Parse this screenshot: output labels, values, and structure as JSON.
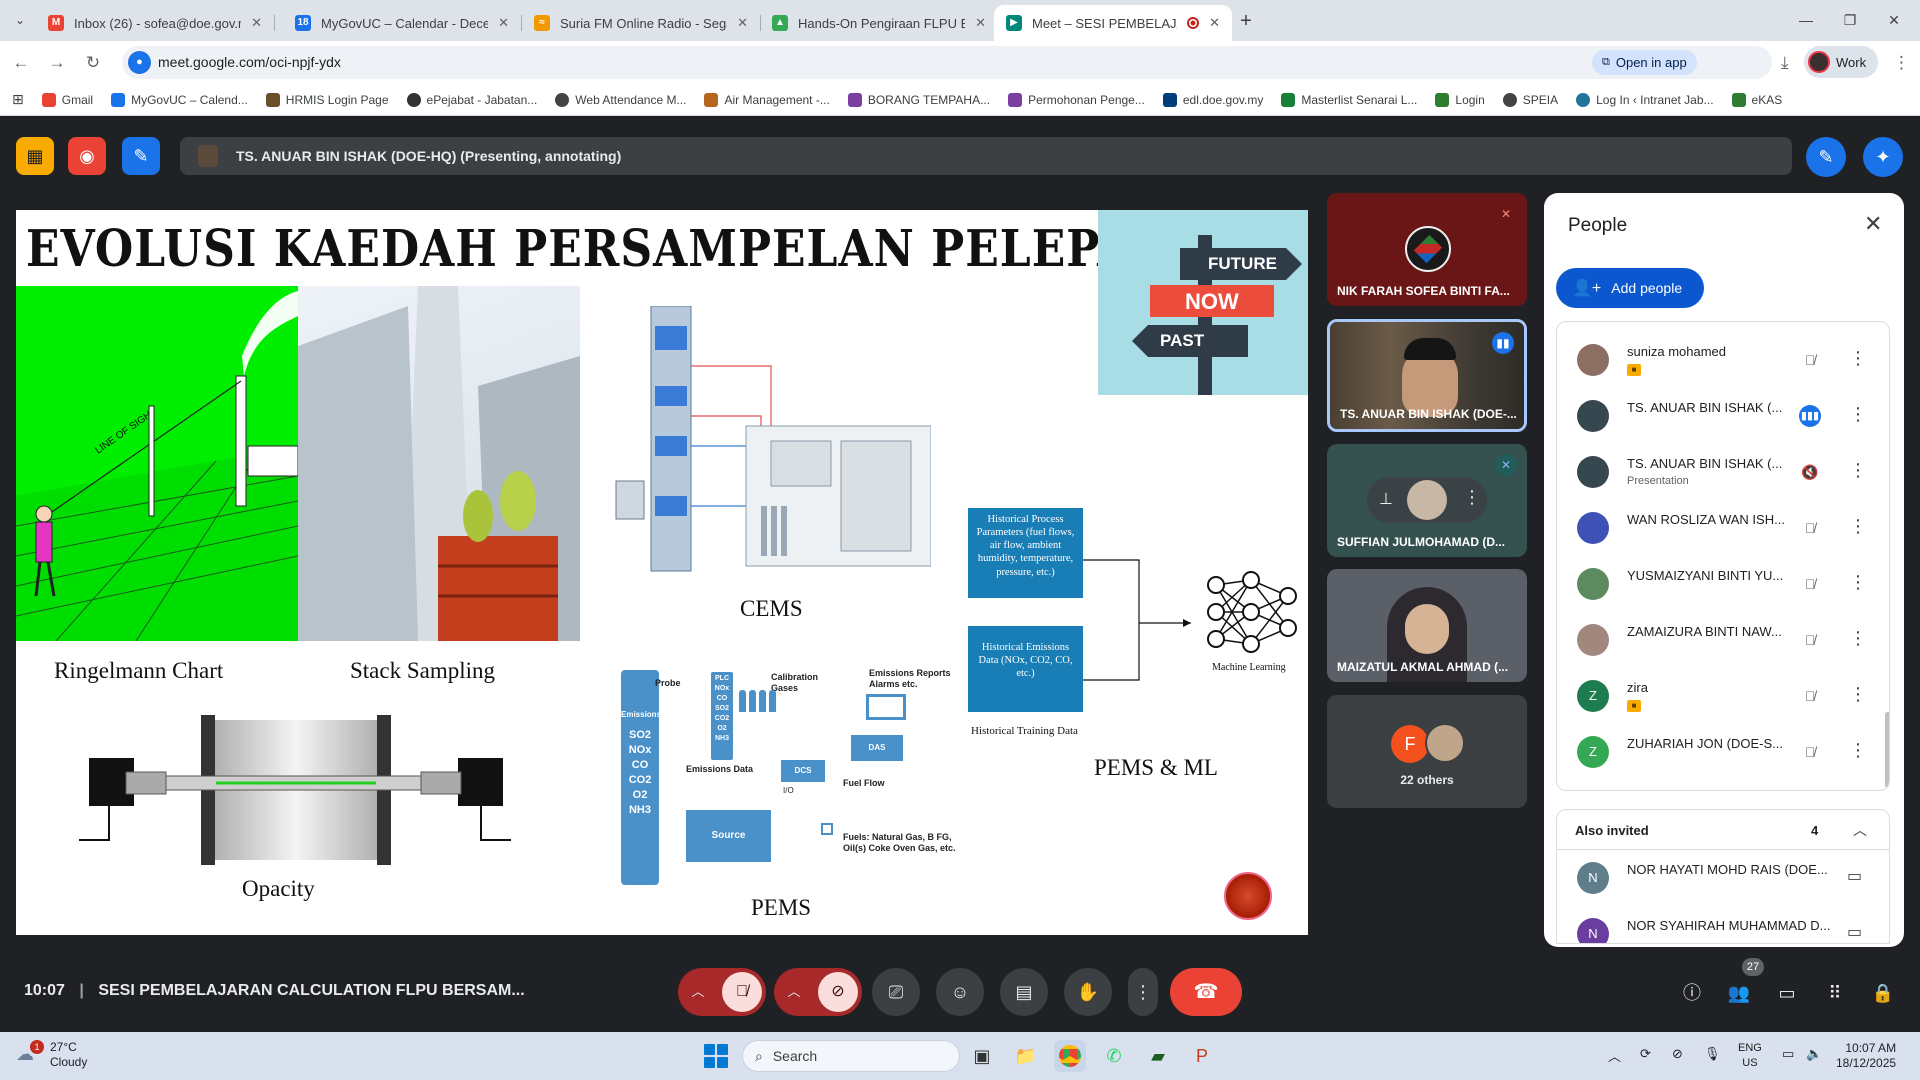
{
  "browser": {
    "tabs": [
      {
        "label": "Inbox (26) - sofea@doe.gov.my",
        "favicon": "gmail-icon",
        "color": "#ea4335"
      },
      {
        "label": "MyGovUC – Calendar - Decemb",
        "favicon": "calendar-icon",
        "color": "#1a73e8"
      },
      {
        "label": "Suria FM Online Radio - Segala",
        "favicon": "radio-icon",
        "color": "#f29900"
      },
      {
        "label": "Hands-On Pengiraan FLPU Bers",
        "favicon": "drive-icon",
        "color": "#34a853"
      },
      {
        "label": "Meet – SESI PEMBELAJARA",
        "favicon": "meet-icon",
        "color": "#00897b"
      }
    ],
    "url": "meet.google.com/oci-npjf-ydx",
    "open_in_app": "Open in app",
    "profile_label": "Work",
    "bookmarks": [
      {
        "label": "Gmail",
        "color": "#ea4335"
      },
      {
        "label": "MyGovUC – Calend...",
        "color": "#1a73e8"
      },
      {
        "label": "HRMIS Login Page",
        "color": "#6b4f2a"
      },
      {
        "label": "ePejabat - Jabatan...",
        "color": "#333333"
      },
      {
        "label": "Web Attendance M...",
        "color": "#444444"
      },
      {
        "label": "Air Management -...",
        "color": "#b5651d"
      },
      {
        "label": "BORANG TEMPAHA...",
        "color": "#7b3fa0"
      },
      {
        "label": "Permohonan Penge...",
        "color": "#7b3fa0"
      },
      {
        "label": "edl.doe.gov.my",
        "color": "#003d7a"
      },
      {
        "label": "Masterlist Senarai L...",
        "color": "#188038"
      },
      {
        "label": "Login",
        "color": "#2e7d32"
      },
      {
        "label": "SPEIA",
        "color": "#444444"
      },
      {
        "label": "Log In ‹ Intranet Jab...",
        "color": "#21759b"
      },
      {
        "label": "eKAS",
        "color": "#2e7d32"
      }
    ]
  },
  "meet": {
    "presenting_banner": "TS. ANUAR BIN ISHAK (DOE-HQ) (Presenting, annotating)",
    "clock": "10:07",
    "meeting_title": "SESI PEMBELAJARAN CALCULATION FLPU BERSAM...",
    "people_count": "27"
  },
  "slide": {
    "title": "EVOLUSI KAEDAH PERSAMPELAN PELEPASAN CEROBONG",
    "ringelmann_caption": "Ringelmann Chart",
    "stack_caption": "Stack Sampling",
    "opacity_caption": "Opacity",
    "cems_caption": "CEMS",
    "pems_caption": "PEMS",
    "pems_ml_caption": "PEMS & ML",
    "sign_future": "FUTURE",
    "sign_now": "NOW",
    "sign_past": "PAST",
    "sight_label": "LINE OF SIGHT",
    "box_process": "Historical Process Parameters (fuel flows, air flow, ambient humidity, temperature, pressure, etc.)",
    "box_emissions": "Historical Emissions Data (NOx, CO2, CO, etc.)",
    "training_label": "Historical Training Data",
    "ml_label": "Machine Learning",
    "pems_diagram": {
      "probe": "Probe",
      "calibration": "Calibration Gases",
      "reports": "Emissions Reports Alarms etc.",
      "emissions": "Emissions",
      "gases": [
        "SO2",
        "NOx",
        "CO",
        "CO2",
        "O2",
        "NH3"
      ],
      "plc": [
        "PLC",
        "NOx",
        "CO",
        "SO2",
        "CO2",
        "O2",
        "NH3"
      ],
      "das": "DAS",
      "dcs": "DCS",
      "emissions_data": "Emissions Data",
      "io": "I/O",
      "fuel_flow": "Fuel Flow",
      "source": "Source",
      "fuels": "Fuels: Natural Gas, B FG, Oil(s) Coke Oven Gas, etc."
    }
  },
  "tiles": [
    {
      "name": "NIK FARAH SOFEA BINTI FA..."
    },
    {
      "name": "TS. ANUAR BIN ISHAK (DOE-..."
    },
    {
      "name": "SUFFIAN JULMOHAMAD (D..."
    },
    {
      "name": "MAIZATUL AKMAL AHMAD (..."
    },
    {
      "name": "22 others",
      "initial": "F"
    }
  ],
  "people_panel": {
    "title": "People",
    "add_people": "Add people",
    "participants": [
      {
        "name": "suniza mohamed",
        "badge": true,
        "avatar_color": "#8d6e63"
      },
      {
        "name": "TS. ANUAR BIN ISHAK (...",
        "active": true,
        "avatar_color": "#37474f"
      },
      {
        "name": "TS. ANUAR BIN ISHAK (...",
        "sub": "Presentation",
        "avatar_color": "#37474f"
      },
      {
        "name": "WAN ROSLIZA WAN ISH...",
        "avatar_color": "#3f51b5"
      },
      {
        "name": "YUSMAIZYANI BINTI YU...",
        "avatar_color": "#5d8a5e"
      },
      {
        "name": "ZAMAIZURA BINTI NAW...",
        "avatar_color": "#a1887f"
      },
      {
        "name": "zira",
        "badge": true,
        "initial": "Z",
        "avatar_color": "#1e7d4e"
      },
      {
        "name": "ZUHARIAH JON (DOE-S...",
        "initial": "Z",
        "avatar_color": "#34a853"
      }
    ],
    "also_invited_title": "Also invited",
    "also_invited_count": "4",
    "invited": [
      {
        "name": "NOR HAYATI MOHD RAIS (DOE...",
        "initial": "N",
        "avatar_color": "#607d8b"
      },
      {
        "name": "NOR SYAHIRAH MUHAMMAD D...",
        "initial": "N",
        "avatar_color": "#6a3ea1"
      }
    ]
  },
  "taskbar": {
    "temperature": "27°C",
    "condition": "Cloudy",
    "weather_badge": "1",
    "search_placeholder": "Search",
    "lang_top": "ENG",
    "lang_bottom": "US",
    "time": "10:07 AM",
    "date": "18/12/2025"
  }
}
